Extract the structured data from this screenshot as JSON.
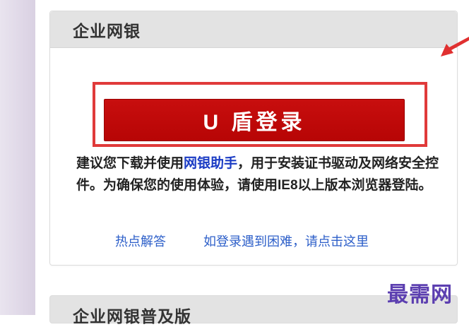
{
  "panel": {
    "title": "企业网银",
    "button_label": "U 盾登录",
    "description": {
      "part1": "建议您下载并使用",
      "link": "网银助手",
      "part2": "，用于安装证书驱动及网络安全控件。为确保您的使用体验，请使用IE8以上版本浏览器登陆。"
    },
    "links": {
      "faq": "热点解答",
      "help": "如登录遇到困难，请点击这里"
    }
  },
  "panel2": {
    "title": "企业网银普及版"
  },
  "watermark": "最需网",
  "colors": {
    "button_red": "#c00808",
    "highlight_border": "#e03a3a",
    "link_blue": "#1a3bc4",
    "watermark_purple": "#5c3fb0"
  }
}
